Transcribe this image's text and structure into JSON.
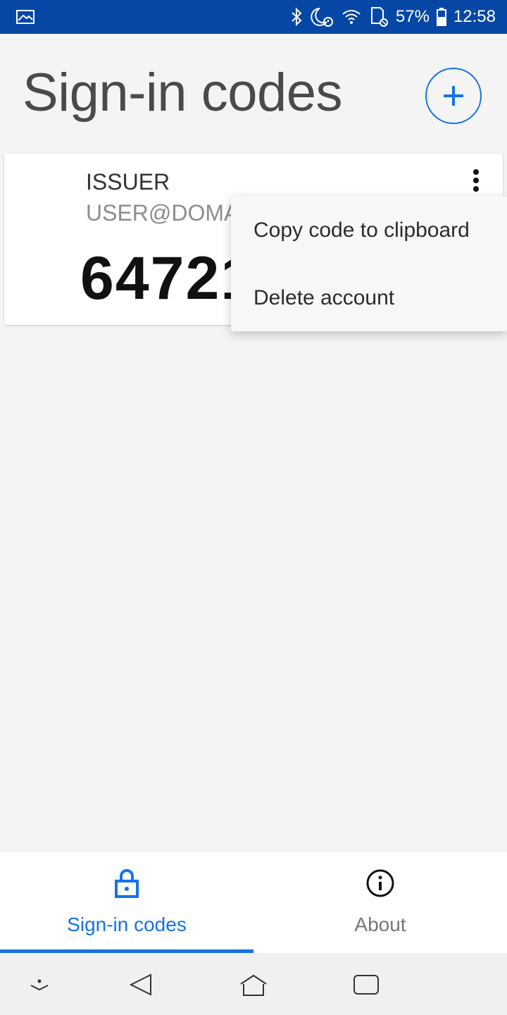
{
  "status_bar": {
    "battery_percent": "57%",
    "time": "12:58",
    "icons": [
      "image-icon",
      "bluetooth-icon",
      "moon-alarm-icon",
      "wifi-icon",
      "sd-card-icon",
      "battery-icon"
    ],
    "bg_color": "#0647a6"
  },
  "header": {
    "title": "Sign-in codes",
    "add_icon": "plus-icon",
    "accent_color": "#1473e6"
  },
  "account_card": {
    "issuer": "ISSUER",
    "user": "USER@DOMA",
    "code": "64721",
    "menu_icon": "more-vertical-icon"
  },
  "context_menu": {
    "items": [
      {
        "label": "Copy code to clipboard"
      },
      {
        "label": "Delete account"
      }
    ]
  },
  "bottom_nav": {
    "tabs": [
      {
        "label": "Sign-in codes",
        "icon": "lock-icon",
        "active": true
      },
      {
        "label": "About",
        "icon": "info-icon",
        "active": false
      }
    ]
  },
  "system_nav": {
    "icons": [
      "chevron-down-icon",
      "back-icon",
      "home-icon",
      "recents-icon"
    ]
  }
}
